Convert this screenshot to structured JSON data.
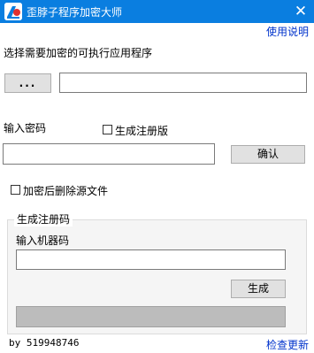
{
  "window": {
    "title": "歪脖子程序加密大师",
    "close_glyph": "✕"
  },
  "help_link": "使用说明",
  "select_program": {
    "label": "选择需要加密的可执行应用程序",
    "browse_button": "...",
    "path_value": ""
  },
  "password": {
    "label": "输入密码",
    "register_checkbox_label": "生成注册版",
    "register_checked": false,
    "value": "",
    "confirm_button": "确认"
  },
  "delete_source": {
    "label": "加密后删除源文件",
    "checked": false
  },
  "register_group": {
    "title": "生成注册码",
    "machine_code_label": "输入机器码",
    "machine_code_value": "",
    "generate_button": "生成",
    "output_value": ""
  },
  "footer": {
    "author": "by 519948746",
    "update_link": "检查更新"
  }
}
